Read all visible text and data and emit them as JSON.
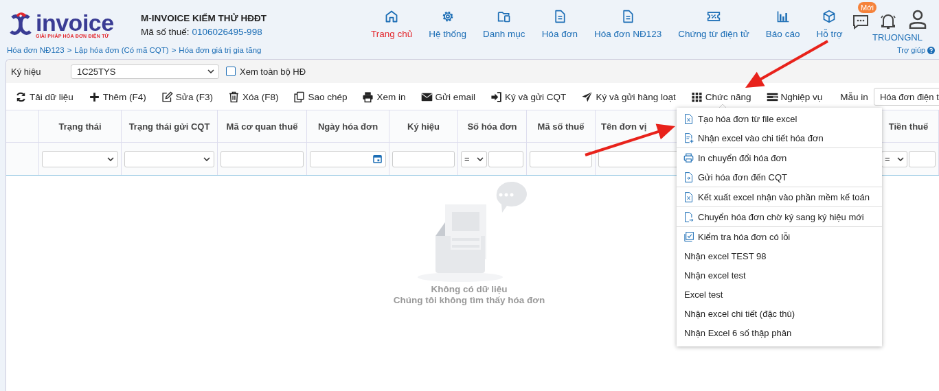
{
  "header": {
    "logo": {
      "wordmark": "invoice",
      "tagline": "GIẢI PHÁP HÓA ĐƠN ĐIỆN TỬ"
    },
    "company": "M-INVOICE KIỂM THỬ HĐĐT",
    "tax_label": "Mã số thuế:",
    "tax_code": "0106026495-998",
    "breadcrumb": [
      "Hóa đơn NĐ123",
      "Lập hóa đơn (Có mã CQT)",
      "Hóa đơn giá trị gia tăng"
    ],
    "breadcrumb_separator": ">",
    "nav": [
      {
        "kind": "home",
        "label": "Trang chủ",
        "selected": true
      },
      {
        "kind": "gear",
        "label": "Hệ thống",
        "selected": false
      },
      {
        "kind": "folder",
        "label": "Danh mục",
        "selected": false
      },
      {
        "kind": "doc",
        "label": "Hóa đơn",
        "selected": false
      },
      {
        "kind": "doc",
        "label": "Hóa đơn NĐ123",
        "selected": false
      },
      {
        "kind": "ticket",
        "label": "Chứng từ điện tử",
        "selected": false
      },
      {
        "kind": "chart",
        "label": "Báo cáo",
        "selected": false
      },
      {
        "kind": "cube",
        "label": "Hỗ trợ",
        "selected": false
      }
    ],
    "chat_badge": "Mới",
    "user": "TRUONGNL",
    "help": "Trợ giúp"
  },
  "filter": {
    "label": "Ký hiệu",
    "value": "1C25TYS",
    "show_all": {
      "label": "Xem toàn bộ HĐ",
      "checked": false
    }
  },
  "toolbar": [
    {
      "kind": "refresh",
      "label": "Tải dữ liệu"
    },
    {
      "kind": "plus",
      "label": "Thêm (F4)"
    },
    {
      "kind": "edit",
      "label": "Sửa (F3)"
    },
    {
      "kind": "trash",
      "label": "Xóa (F8)"
    },
    {
      "kind": "copy",
      "label": "Sao chép"
    },
    {
      "kind": "print",
      "label": "Xem in"
    },
    {
      "kind": "mail",
      "label": "Gửi email"
    },
    {
      "kind": "signin",
      "label": "Ký và gửi CQT"
    },
    {
      "kind": "plane",
      "label": "Ký và gửi hàng loạt"
    },
    {
      "kind": "grid",
      "label": "Chức năng",
      "expanded": true
    },
    {
      "kind": "bars",
      "label": "Nghiệp vụ"
    }
  ],
  "print_template": {
    "label": "Mẫu in",
    "value": "Hóa đơn điện t"
  },
  "table": {
    "columns": [
      {
        "label": "Trạng thái",
        "filter": {
          "kind": "select"
        }
      },
      {
        "label": "Trạng thái gửi CQT",
        "filter": {
          "kind": "select"
        }
      },
      {
        "label": "Mã cơ quan thuế",
        "filter": {
          "kind": "text"
        }
      },
      {
        "label": "Ngày hóa đơn",
        "filter": {
          "kind": "date"
        }
      },
      {
        "label": "Ký hiệu",
        "filter": {
          "kind": "text"
        }
      },
      {
        "label": "Số hóa đơn",
        "filter": {
          "kind": "number",
          "operator": "="
        }
      },
      {
        "label": "Mã số thuế",
        "filter": {
          "kind": "text"
        }
      },
      {
        "label": "Tên đơn vị",
        "filter": {
          "kind": "text"
        }
      },
      {
        "label": "Tiền thuế",
        "filter": {
          "kind": "number",
          "operator": "="
        }
      }
    ],
    "empty": {
      "title": "Không có dữ liệu",
      "message": "Chúng tôi không tìm thấy hóa đơn"
    }
  },
  "menu": {
    "sections": [
      [
        {
          "kind": "excel",
          "label": "Tạo hóa đơn từ file excel"
        },
        {
          "kind": "fileplus",
          "label": "Nhận excel vào chi tiết hóa đơn"
        }
      ],
      [
        {
          "kind": "print",
          "label": "In chuyển đổi hóa đơn"
        },
        {
          "kind": "filesend",
          "label": "Gửi hóa đơn đến CQT"
        }
      ],
      [
        {
          "kind": "excel",
          "label": "Kết xuất excel nhận vào phần mềm kế toán"
        }
      ],
      [
        {
          "kind": "filemove",
          "label": "Chuyển hóa đơn chờ ký sang ký hiệu mới"
        }
      ],
      [
        {
          "kind": "check",
          "label": "Kiểm tra hóa đơn có lỗi"
        },
        {
          "kind": "plain",
          "label": "Nhận excel TEST 98"
        },
        {
          "kind": "plain",
          "label": "Nhận excel test"
        },
        {
          "kind": "plain",
          "label": "Excel test"
        },
        {
          "kind": "plain",
          "label": "Nhận excel chi tiết (đặc thù)"
        },
        {
          "kind": "plain",
          "label": "Nhận Excel 6 số thập phân"
        }
      ]
    ]
  },
  "annotations": [
    {
      "kind": "arrow"
    },
    {
      "kind": "arrow"
    }
  ]
}
